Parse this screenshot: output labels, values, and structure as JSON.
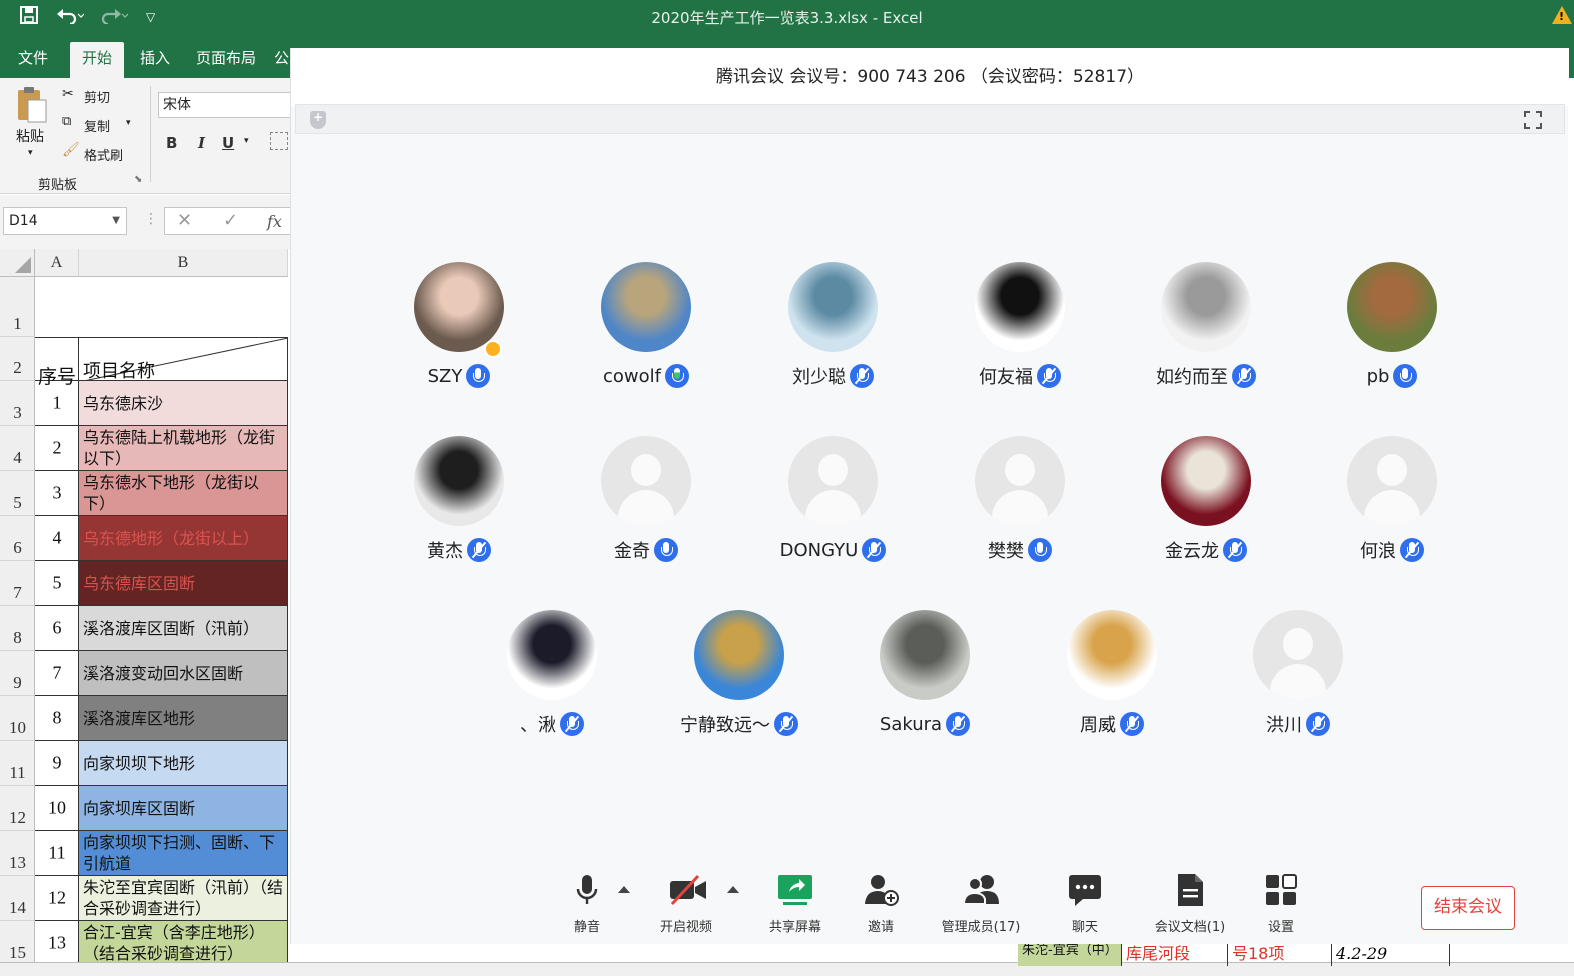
{
  "excel": {
    "window_title": "2020年生产工作一览表3.3.xlsx  -  Excel",
    "warning_glyph": "!",
    "ribbon_tabs": [
      "文件",
      "开始",
      "插入",
      "页面布局",
      "公"
    ],
    "active_tab": "开始",
    "clipboard": {
      "paste": "粘贴",
      "cut": "剪切",
      "copy": "复制",
      "format_painter": "格式刷",
      "group_label": "剪贴板"
    },
    "font_name": "宋体",
    "font_buttons": [
      "B",
      "I",
      "U"
    ],
    "name_box": "D14",
    "fx": "fx",
    "columns": [
      "A",
      "B"
    ],
    "row_numbers": [
      "1",
      "2",
      "3",
      "4",
      "5",
      "6",
      "7",
      "8",
      "9",
      "10",
      "11",
      "12",
      "13",
      "14",
      "15"
    ],
    "header_row": {
      "seq": "序号",
      "name": "项目名称"
    },
    "rows": [
      {
        "seq": "1",
        "name": "乌东德床沙",
        "fill": "#f2dcdb"
      },
      {
        "seq": "2",
        "name": "乌东德陆上机载地形（龙街以下）",
        "fill": "#e6b8b7"
      },
      {
        "seq": "3",
        "name": "乌东德水下地形（龙街以下）",
        "fill": "#da9694"
      },
      {
        "seq": "4",
        "name": "乌东德地形（龙街以上）",
        "fill": "#963634"
      },
      {
        "seq": "5",
        "name": "乌东德库区固断",
        "fill": "#632523"
      },
      {
        "seq": "6",
        "name": "溪洛渡库区固断（汛前）",
        "fill": "#d9d9d9"
      },
      {
        "seq": "7",
        "name": "溪洛渡变动回水区固断",
        "fill": "#bfbfbf"
      },
      {
        "seq": "8",
        "name": "溪洛渡库区地形",
        "fill": "#808080"
      },
      {
        "seq": "9",
        "name": "向家坝坝下地形",
        "fill": "#c5d9f1"
      },
      {
        "seq": "10",
        "name": "向家坝库区固断",
        "fill": "#8db4e2"
      },
      {
        "seq": "11",
        "name": "向家坝坝下扫测、固断、下引航道",
        "fill": "#538dd5"
      },
      {
        "seq": "12",
        "name": "朱沱至宜宾固断（汛前）（结合采砂调查进行）",
        "fill": "#ebf1de"
      },
      {
        "seq": "13",
        "name": "合江-宜宾（含李庄地形）（结合采砂调查进行）",
        "fill": "#c4d79b"
      }
    ],
    "bottom_cells": [
      "朱沱-宜宾（中）",
      "库尾河段",
      "号18项",
      "4.2-29"
    ]
  },
  "meeting": {
    "header": "腾讯会议 会议号：900 743 206 （会议密码：52817）",
    "participants": [
      {
        "name": "SZY",
        "avatar": "photo-girl-doll",
        "mic": "on",
        "host": true,
        "colors": [
          "#6b5a4e",
          "#e9c9b8"
        ]
      },
      {
        "name": "cowolf",
        "avatar": "photo-landscape-sky",
        "mic": "speaking",
        "colors": [
          "#4f86c8",
          "#b9a57c"
        ]
      },
      {
        "name": "刘少聪",
        "avatar": "photo-fountain",
        "mic": "muted",
        "colors": [
          "#cfe3ef",
          "#5c8aa3"
        ]
      },
      {
        "name": "何友福",
        "avatar": "photo-jump-silhouette",
        "mic": "muted",
        "colors": [
          "#ffffff",
          "#111111"
        ]
      },
      {
        "name": "如约而至",
        "avatar": "photo-baby-face",
        "mic": "muted",
        "colors": [
          "#f2f2f2",
          "#9a9a9a"
        ]
      },
      {
        "name": "pb",
        "avatar": "photo-forest",
        "mic": "on",
        "colors": [
          "#6b7d3d",
          "#a36a3e"
        ]
      },
      {
        "name": "黄杰",
        "avatar": "photo-man-portrait",
        "mic": "muted",
        "colors": [
          "#e8e8e8",
          "#1e1e1e"
        ]
      },
      {
        "name": "金奇",
        "avatar": "default",
        "mic": "on"
      },
      {
        "name": "DONGYU",
        "avatar": "default",
        "mic": "muted"
      },
      {
        "name": "樊樊",
        "avatar": "default",
        "mic": "on"
      },
      {
        "name": "金云龙",
        "avatar": "photo-anime-character",
        "mic": "muted",
        "colors": [
          "#7a1120",
          "#e9e3d8"
        ]
      },
      {
        "name": "何浪",
        "avatar": "default",
        "mic": "muted"
      },
      {
        "name": "、湫",
        "avatar": "photo-anime-girl",
        "mic": "muted",
        "colors": [
          "#ffffff",
          "#1b1b2a"
        ]
      },
      {
        "name": "宁静致远～",
        "avatar": "photo-mountain",
        "mic": "muted",
        "colors": [
          "#3a86d8",
          "#c9a14a"
        ]
      },
      {
        "name": "Sakura",
        "avatar": "photo-person-grey",
        "mic": "muted",
        "colors": [
          "#c9ccc6",
          "#5a5d58"
        ]
      },
      {
        "name": "周威",
        "avatar": "photo-luffy-cartoon",
        "mic": "muted",
        "colors": [
          "#ffffff",
          "#d8a34a"
        ]
      },
      {
        "name": "洪川",
        "avatar": "default",
        "mic": "muted"
      }
    ],
    "toolbar": [
      {
        "label": "静音",
        "icon": "microphone-icon"
      },
      {
        "label": "开启视频",
        "icon": "video-off-icon"
      },
      {
        "label": "共享屏幕",
        "icon": "share-screen-icon"
      },
      {
        "label": "邀请",
        "icon": "invite-icon"
      },
      {
        "label": "管理成员(17)",
        "icon": "members-icon"
      },
      {
        "label": "聊天",
        "icon": "chat-icon"
      },
      {
        "label": "会议文档(1)",
        "icon": "document-icon"
      },
      {
        "label": "设置",
        "icon": "settings-icon"
      }
    ],
    "end_button": "结束会议",
    "colors": {
      "mic_blue": "#2f6fed",
      "end_red": "#e0433b",
      "share_green": "#1aa35c"
    }
  }
}
